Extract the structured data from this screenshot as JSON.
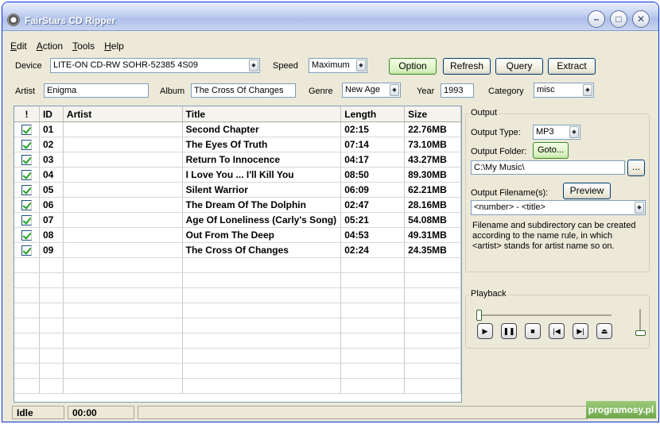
{
  "window": {
    "title": "FairStars CD Ripper"
  },
  "menu": [
    {
      "label": "Edit"
    },
    {
      "label": "Action"
    },
    {
      "label": "Tools"
    },
    {
      "label": "Help"
    }
  ],
  "toolbar": {
    "device_label": "Device",
    "device_value": "LITE-ON CD-RW SOHR-52385 4S09",
    "speed_label": "Speed",
    "speed_value": "Maximum",
    "option_label": "Option",
    "refresh_label": "Refresh",
    "query_label": "Query",
    "extract_label": "Extract"
  },
  "album_info": {
    "artist_label": "Artist",
    "artist_value": "Enigma",
    "album_label": "Album",
    "album_value": "The Cross Of Changes",
    "genre_label": "Genre",
    "genre_value": "New Age",
    "year_label": "Year",
    "year_value": "1993",
    "category_label": "Category",
    "category_value": "misc"
  },
  "tracklist": {
    "headers": [
      "!",
      "ID",
      "Artist",
      "Title",
      "Length",
      "Size"
    ],
    "rows": [
      {
        "id": "01",
        "artist": "",
        "title": "Second Chapter",
        "length": "02:15",
        "size": "22.76MB"
      },
      {
        "id": "02",
        "artist": "",
        "title": "The Eyes Of Truth",
        "length": "07:14",
        "size": "73.10MB"
      },
      {
        "id": "03",
        "artist": "",
        "title": "Return To Innocence",
        "length": "04:17",
        "size": "43.27MB"
      },
      {
        "id": "04",
        "artist": "",
        "title": "I Love You ... I'll Kill You",
        "length": "08:50",
        "size": "89.30MB"
      },
      {
        "id": "05",
        "artist": "",
        "title": "Silent Warrior",
        "length": "06:09",
        "size": "62.21MB"
      },
      {
        "id": "06",
        "artist": "",
        "title": "The Dream Of The Dolphin",
        "length": "02:47",
        "size": "28.16MB"
      },
      {
        "id": "07",
        "artist": "",
        "title": "Age Of Loneliness (Carly's Song)",
        "length": "05:21",
        "size": "54.08MB"
      },
      {
        "id": "08",
        "artist": "",
        "title": "Out From The Deep",
        "length": "04:53",
        "size": "49.31MB"
      },
      {
        "id": "09",
        "artist": "",
        "title": "The Cross Of Changes",
        "length": "02:24",
        "size": "24.35MB"
      }
    ]
  },
  "output": {
    "group_title": "Output",
    "type_label": "Output Type:",
    "type_value": "MP3",
    "folder_label": "Output Folder:",
    "goto_label": "Goto...",
    "folder_value": "C:\\My Music\\",
    "browse_label": "...",
    "filename_label": "Output Filename(s):",
    "preview_label": "Preview",
    "filename_value": "<number> - <title>",
    "note": "Filename and subdirectory can be created according to the name rule, in which <artist> stands for artist name so on."
  },
  "playback": {
    "group_title": "Playback",
    "position": 0,
    "volume": 0
  },
  "status": {
    "state": "Idle",
    "time": "00:00"
  },
  "watermark": "programosy.pl"
}
